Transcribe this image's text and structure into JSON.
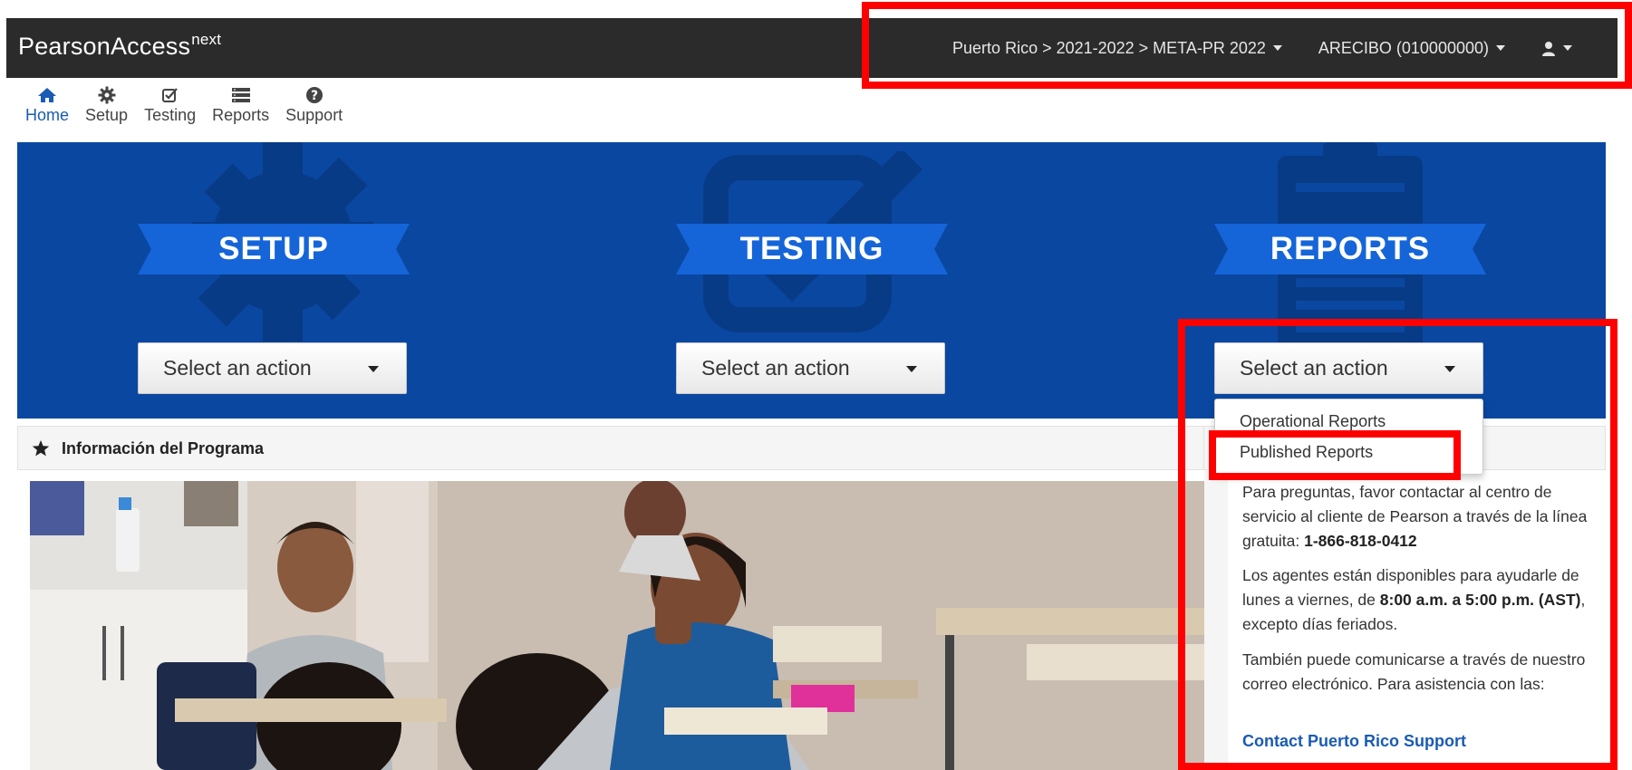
{
  "navbar": {
    "brand": "PearsonAccess",
    "brand_sup": "next",
    "context_selector": "Puerto Rico > 2021-2022 > META-PR 2022",
    "org_selector": "ARECIBO (010000000)"
  },
  "subnav": {
    "items": [
      {
        "label": "Home"
      },
      {
        "label": "Setup"
      },
      {
        "label": "Testing"
      },
      {
        "label": "Reports"
      },
      {
        "label": "Support"
      }
    ]
  },
  "hero": {
    "setup_label": "SETUP",
    "testing_label": "TESTING",
    "reports_label": "REPORTS",
    "select_placeholder": "Select an action",
    "accent_color": "#0a47a1"
  },
  "reports_dropdown": {
    "items": [
      "Operational Reports",
      "Published Reports"
    ]
  },
  "info_panel": {
    "title": "Información del Programa"
  },
  "side_panel": {
    "p1_text": "Para preguntas, favor contactar al centro de servicio al cliente de Pearson a través de la línea gratuita: ",
    "p1_phone": "1-866-818-0412",
    "p2_text_a": "Los agentes están disponibles para ayudarle de lunes a viernes, de ",
    "p2_hours": "8:00 a.m. a 5:00 p.m. (AST)",
    "p2_text_b": ", excepto días feriados.",
    "p3_text": "También puede comunicarse a través de nuestro correo electrónico. Para asistencia con las:",
    "support_link": "Contact Puerto Rico Support",
    "link_color": "#1a5bb3"
  }
}
